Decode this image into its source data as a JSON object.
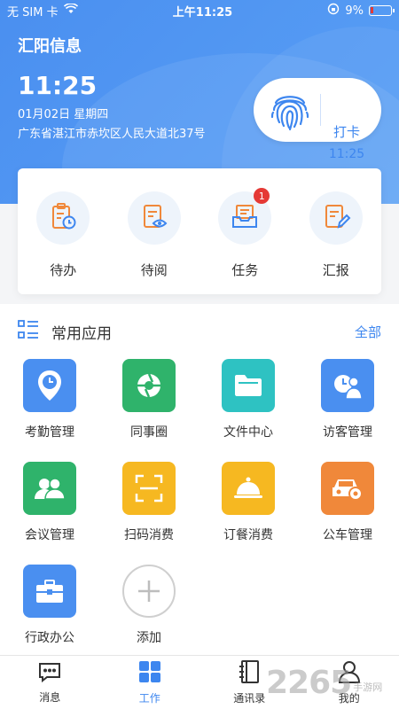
{
  "status_bar": {
    "carrier": "无 SIM 卡",
    "time": "上午11:25",
    "battery": "9%"
  },
  "header": {
    "company": "汇阳信息",
    "time": "11:25",
    "date": "01月02日 星期四",
    "address": "广东省湛江市赤坎区人民大道北37号"
  },
  "punch": {
    "label": "打卡",
    "time": "11:25"
  },
  "quick_actions": [
    {
      "label": "待办",
      "icon": "clipboard-clock-icon"
    },
    {
      "label": "待阅",
      "icon": "document-eye-icon"
    },
    {
      "label": "任务",
      "icon": "inbox-tray-icon",
      "badge": "1"
    },
    {
      "label": "汇报",
      "icon": "document-edit-icon"
    }
  ],
  "apps_section": {
    "title": "常用应用",
    "all_label": "全部"
  },
  "apps": [
    {
      "label": "考勤管理",
      "icon": "location-clock-icon",
      "color": "#4a8ff0"
    },
    {
      "label": "同事圈",
      "icon": "aperture-icon",
      "color": "#2fb36b"
    },
    {
      "label": "文件中心",
      "icon": "folder-icon",
      "color": "#2ec2c2"
    },
    {
      "label": "访客管理",
      "icon": "visitor-icon",
      "color": "#4a8ff0"
    },
    {
      "label": "会议管理",
      "icon": "people-icon",
      "color": "#2fb36b"
    },
    {
      "label": "扫码消费",
      "icon": "scan-icon",
      "color": "#f6b821"
    },
    {
      "label": "订餐消费",
      "icon": "food-cloche-icon",
      "color": "#f6b821"
    },
    {
      "label": "公车管理",
      "icon": "car-icon",
      "color": "#f0883a"
    },
    {
      "label": "行政办公",
      "icon": "briefcase-icon",
      "color": "#4a8ff0"
    },
    {
      "label": "添加",
      "icon": "plus-icon",
      "color": "#cfcfcf"
    }
  ],
  "bottom_nav": [
    {
      "label": "消息",
      "icon": "chat-icon"
    },
    {
      "label": "工作",
      "icon": "grid-icon",
      "active": true
    },
    {
      "label": "通讯录",
      "icon": "contacts-book-icon"
    },
    {
      "label": "我的",
      "icon": "person-icon"
    }
  ],
  "watermark": {
    "number": "2265",
    "text": "手游网"
  }
}
